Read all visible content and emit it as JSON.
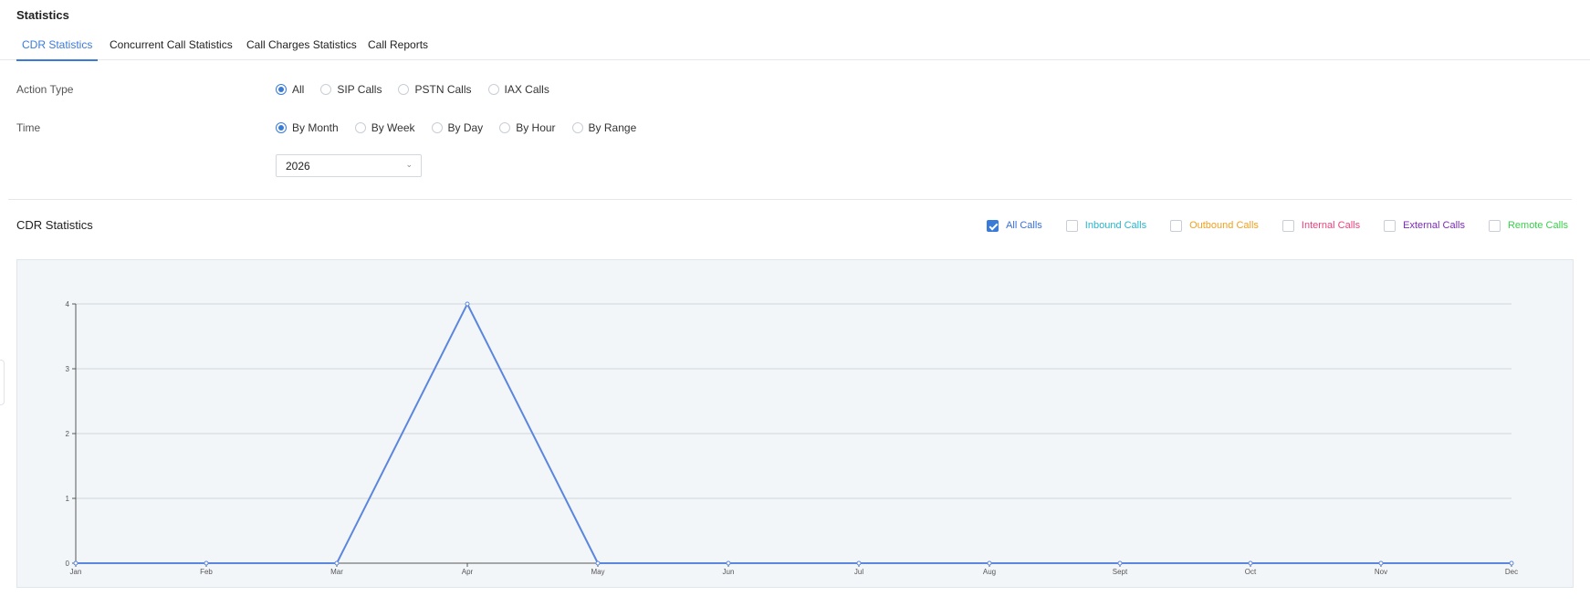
{
  "page": {
    "title": "Statistics"
  },
  "tabs": [
    {
      "label": "CDR Statistics",
      "active": true
    },
    {
      "label": "Concurrent Call Statistics",
      "active": false
    },
    {
      "label": "Call Charges Statistics",
      "active": false
    },
    {
      "label": "Call Reports",
      "active": false
    }
  ],
  "filters": {
    "action_type": {
      "label": "Action Type",
      "options": [
        "All",
        "SIP Calls",
        "PSTN Calls",
        "IAX Calls"
      ],
      "selected": "All"
    },
    "time": {
      "label": "Time",
      "options": [
        "By Month",
        "By Week",
        "By Day",
        "By Hour",
        "By Range"
      ],
      "selected": "By Month"
    },
    "year_select": {
      "value": "2026",
      "icon": "chevron-down-icon"
    }
  },
  "section": {
    "title": "CDR Statistics"
  },
  "legend": [
    {
      "label": "All Calls",
      "color": "#3b6fd6",
      "checked": true
    },
    {
      "label": "Inbound Calls",
      "color": "#2bb4c9",
      "checked": false
    },
    {
      "label": "Outbound Calls",
      "color": "#f0a020",
      "checked": false
    },
    {
      "label": "Internal Calls",
      "color": "#e8457b",
      "checked": false
    },
    {
      "label": "External Calls",
      "color": "#7a2bb6",
      "checked": false
    },
    {
      "label": "Remote Calls",
      "color": "#3ccf4e",
      "checked": false
    }
  ],
  "chart_data": {
    "type": "line",
    "categories": [
      "Jan",
      "Feb",
      "Mar",
      "Apr",
      "May",
      "Jun",
      "Jul",
      "Aug",
      "Sept",
      "Oct",
      "Nov",
      "Dec"
    ],
    "series": [
      {
        "name": "All Calls",
        "color": "#5b86dd",
        "values": [
          0,
          0,
          0,
          4,
          0,
          0,
          0,
          0,
          0,
          0,
          0,
          0
        ]
      }
    ],
    "yticks": [
      0,
      1,
      2,
      3,
      4
    ],
    "ylim": [
      0,
      4
    ],
    "grid": true,
    "title": "",
    "xlabel": "",
    "ylabel": ""
  }
}
